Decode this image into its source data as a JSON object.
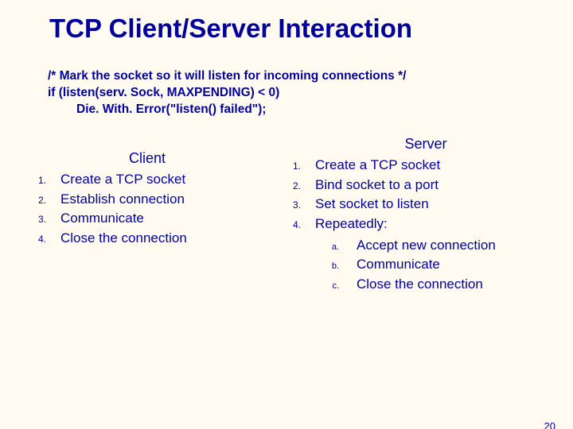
{
  "title": "TCP Client/Server Interaction",
  "code": {
    "line1": "/* Mark the socket so it will listen for incoming connections */",
    "line2": "if (listen(serv. Sock, MAXPENDING) < 0)",
    "line3": "Die. With. Error(\"listen() failed\");"
  },
  "client": {
    "heading": "Client",
    "items": [
      {
        "num": "1.",
        "text": "Create a TCP socket"
      },
      {
        "num": "2.",
        "text": "Establish connection"
      },
      {
        "num": "3.",
        "text": "Communicate"
      },
      {
        "num": "4.",
        "text": "Close the connection"
      }
    ]
  },
  "server": {
    "heading": "Server",
    "items": [
      {
        "num": "1.",
        "text": "Create a TCP socket"
      },
      {
        "num": "2.",
        "text": "Bind socket to a port"
      },
      {
        "num": "3.",
        "text": "Set socket to listen"
      },
      {
        "num": "4.",
        "text": "Repeatedly:"
      }
    ],
    "subitems": [
      {
        "num": "a.",
        "text": "Accept new connection"
      },
      {
        "num": "b.",
        "text": "Communicate"
      },
      {
        "num": "c.",
        "text": "Close the connection"
      }
    ]
  },
  "page_number": "20"
}
